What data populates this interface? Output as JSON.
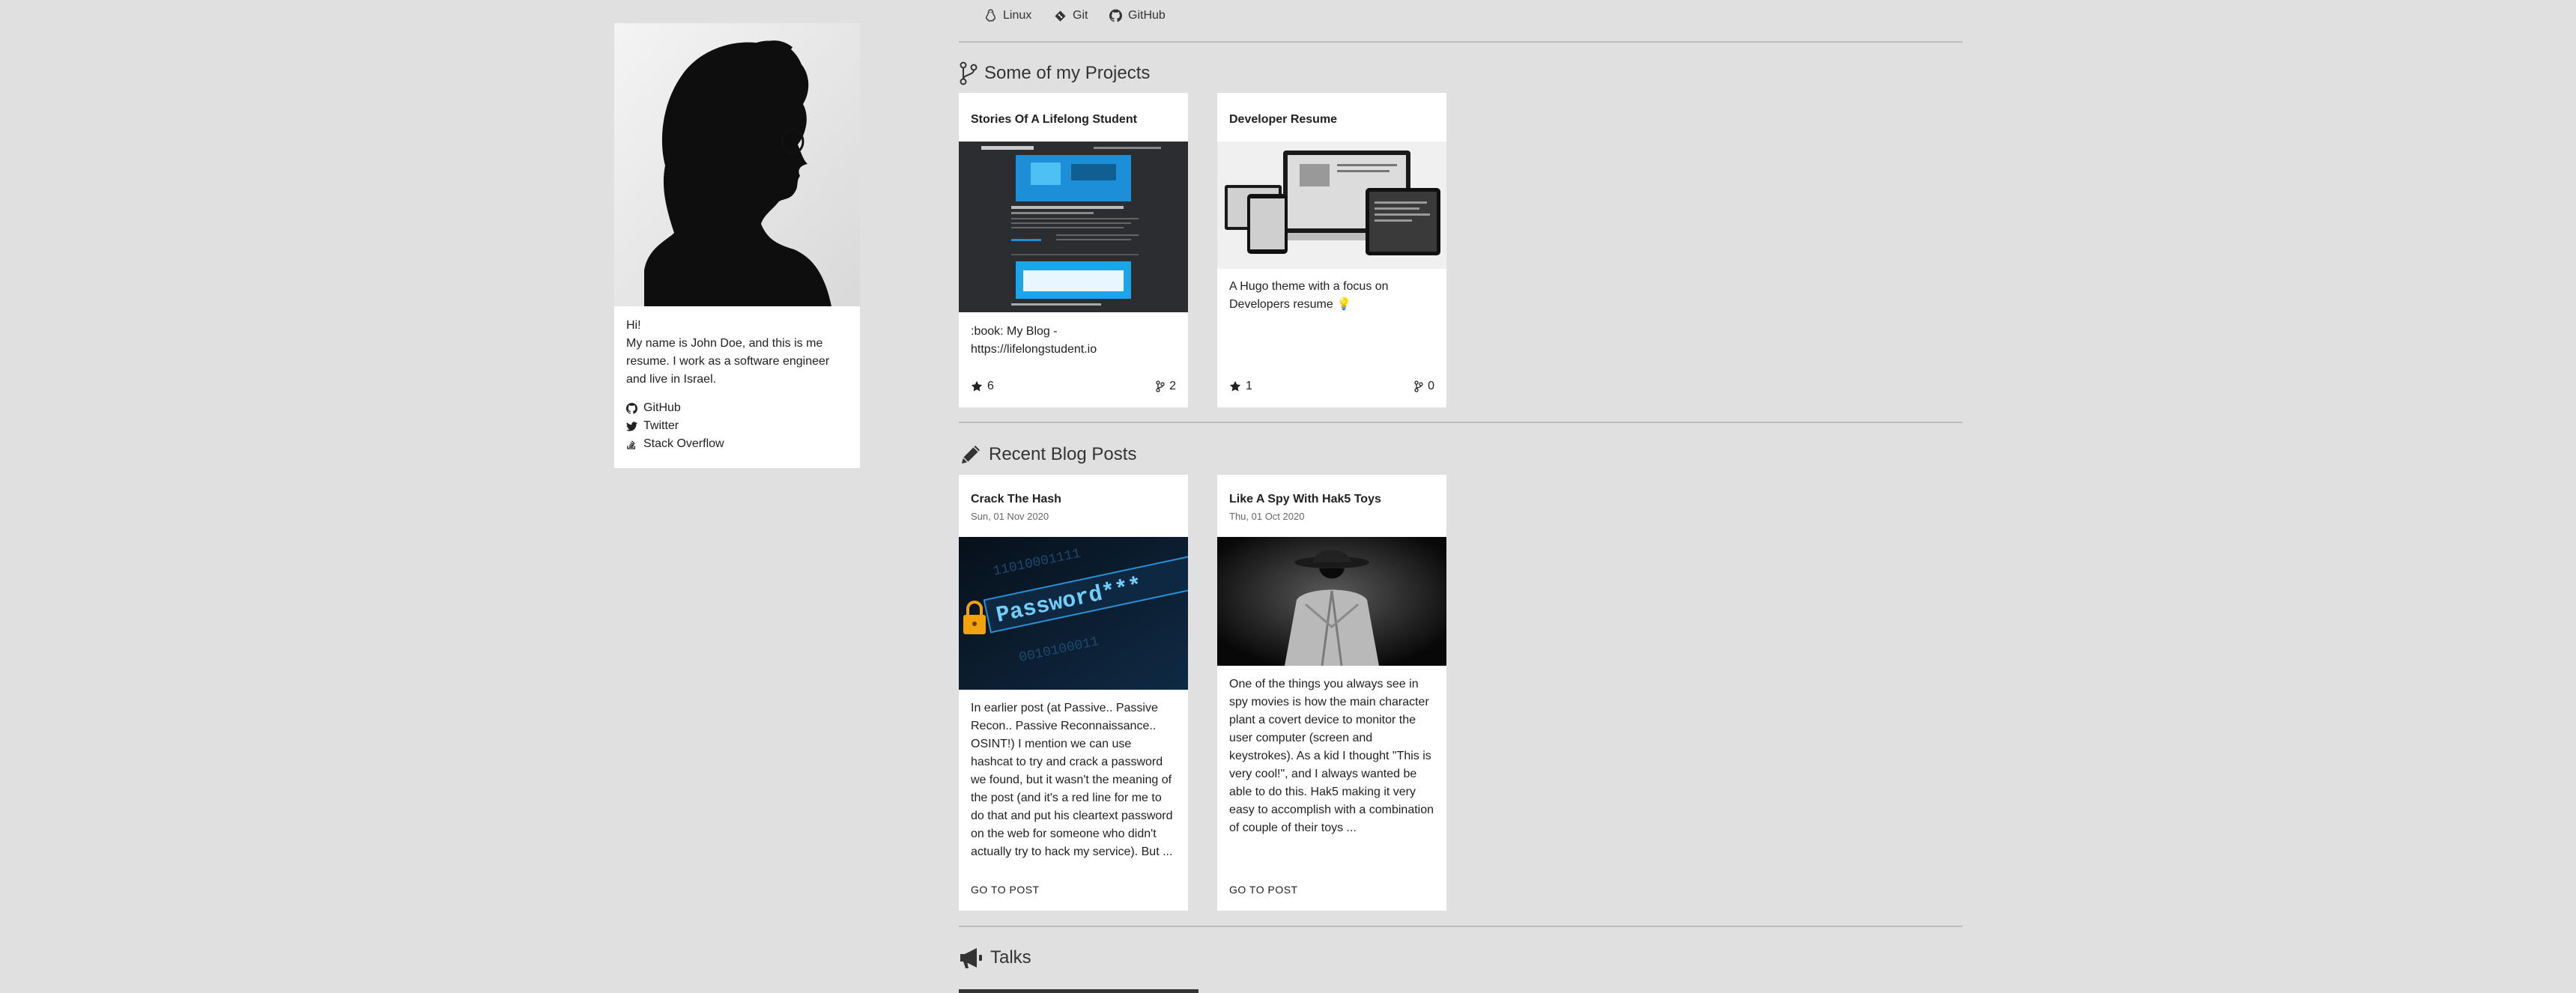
{
  "skills": [
    {
      "label": "Linux",
      "icon": "linux-icon"
    },
    {
      "label": "Git",
      "icon": "git-icon"
    },
    {
      "label": "GitHub",
      "icon": "github-icon"
    }
  ],
  "profile": {
    "greeting": "Hi!",
    "bio": "My name is John Doe, and this is me resume. I work as a software engineer and live in Israel.",
    "links": [
      {
        "label": "GitHub",
        "icon": "github-icon"
      },
      {
        "label": "Twitter",
        "icon": "twitter-icon"
      },
      {
        "label": "Stack Overflow",
        "icon": "stackoverflow-icon"
      }
    ]
  },
  "projects": {
    "title": "Some of my Projects",
    "items": [
      {
        "title": "Stories Of A Lifelong Student",
        "description": ":book: My Blog - https://lifelongstudent.io",
        "stars": "6",
        "forks": "2"
      },
      {
        "title": "Developer Resume",
        "description": "A Hugo theme with a focus on Developers resume 💡",
        "stars": "1",
        "forks": "0"
      }
    ]
  },
  "posts": {
    "title": "Recent Blog Posts",
    "items": [
      {
        "title": "Crack The Hash",
        "date": "Sun, 01 Nov 2020",
        "excerpt": "In earlier post (at Passive.. Passive Recon.. Passive Reconnaissance.. OSINT!) I mention we can use hashcat to try and crack a password we found, but it wasn't the meaning of the post (and it's a red line for me to do that and put his cleartext password on the web for someone who didn't actually try to hack my service). But ...",
        "cta": "GO TO POST"
      },
      {
        "title": "Like A Spy With Hak5 Toys",
        "date": "Thu, 01 Oct 2020",
        "excerpt": "One of the things you always see in spy movies is how the main character plant a covert device to monitor the user computer (screen and keystrokes). As a kid I thought \"This is very cool!\", and I always wanted be able to do this. Hak5 making it very easy to accomplish with a combination of couple of their toys ...",
        "cta": "GO TO POST"
      }
    ]
  },
  "talks": {
    "title": "Talks"
  },
  "colors": {
    "background": "#e0e0e0",
    "card": "#ffffff",
    "rule": "#bdbdbd"
  },
  "images": {
    "password_text": "Password***",
    "password_digits_1": "11010001111",
    "password_digits_2": "0010100011"
  }
}
